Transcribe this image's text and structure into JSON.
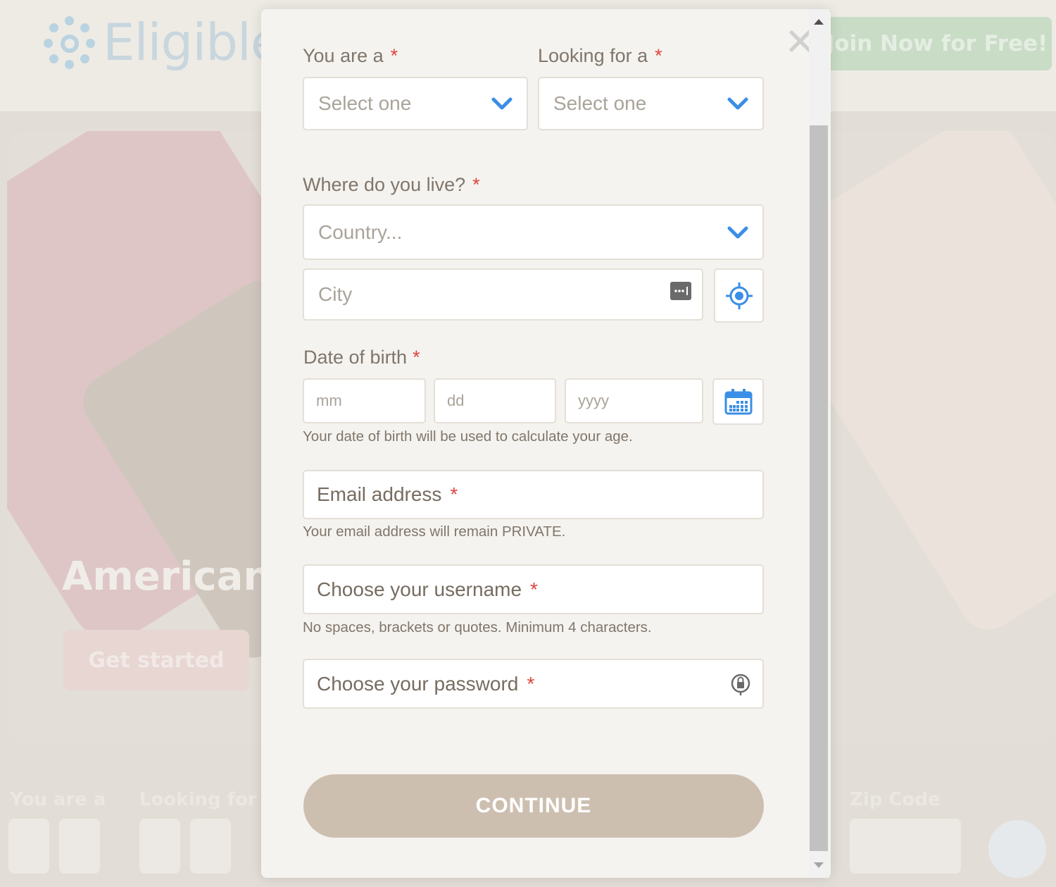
{
  "background": {
    "logo_text": "Eligible",
    "join_button": "Join Now for Free!",
    "hero_heading": "American",
    "hero_button": "Get started",
    "search_labels": {
      "you_are_a": "You are a",
      "looking_for": "Looking for",
      "zip_code": "Zip Code"
    }
  },
  "modal": {
    "close_symbol": "✕",
    "you_are_a": {
      "label": "You are a",
      "required": "*",
      "placeholder": "Select one"
    },
    "looking_for": {
      "label": "Looking for a",
      "required": "*",
      "placeholder": "Select one"
    },
    "location": {
      "label": "Where do you live?",
      "required": "*",
      "country_placeholder": "Country...",
      "city_placeholder": "City"
    },
    "dob": {
      "label": "Date of birth",
      "required": "*",
      "mm_placeholder": "mm",
      "dd_placeholder": "dd",
      "yyyy_placeholder": "yyyy",
      "help": "Your date of birth will be used to calculate your age."
    },
    "email": {
      "placeholder": "Email address",
      "required": "*",
      "help": "Your email address will remain PRIVATE."
    },
    "username": {
      "placeholder": "Choose your username",
      "required": "*",
      "help": "No spaces, brackets or quotes. Minimum 4 characters."
    },
    "password": {
      "placeholder": "Choose your password",
      "required": "*"
    },
    "continue_label": "CONTINUE"
  },
  "colors": {
    "accent_blue": "#3a8ee6",
    "required_red": "#e0443c",
    "continue_bg": "#cdbfb0",
    "label_text": "#80766b"
  },
  "icons": {
    "dropdown": "chevron-down-icon",
    "city_autofill": "autofill-card-icon",
    "locate": "crosshair-locate-icon",
    "calendar": "calendar-icon",
    "password_manager": "password-key-icon",
    "close": "close-icon"
  }
}
